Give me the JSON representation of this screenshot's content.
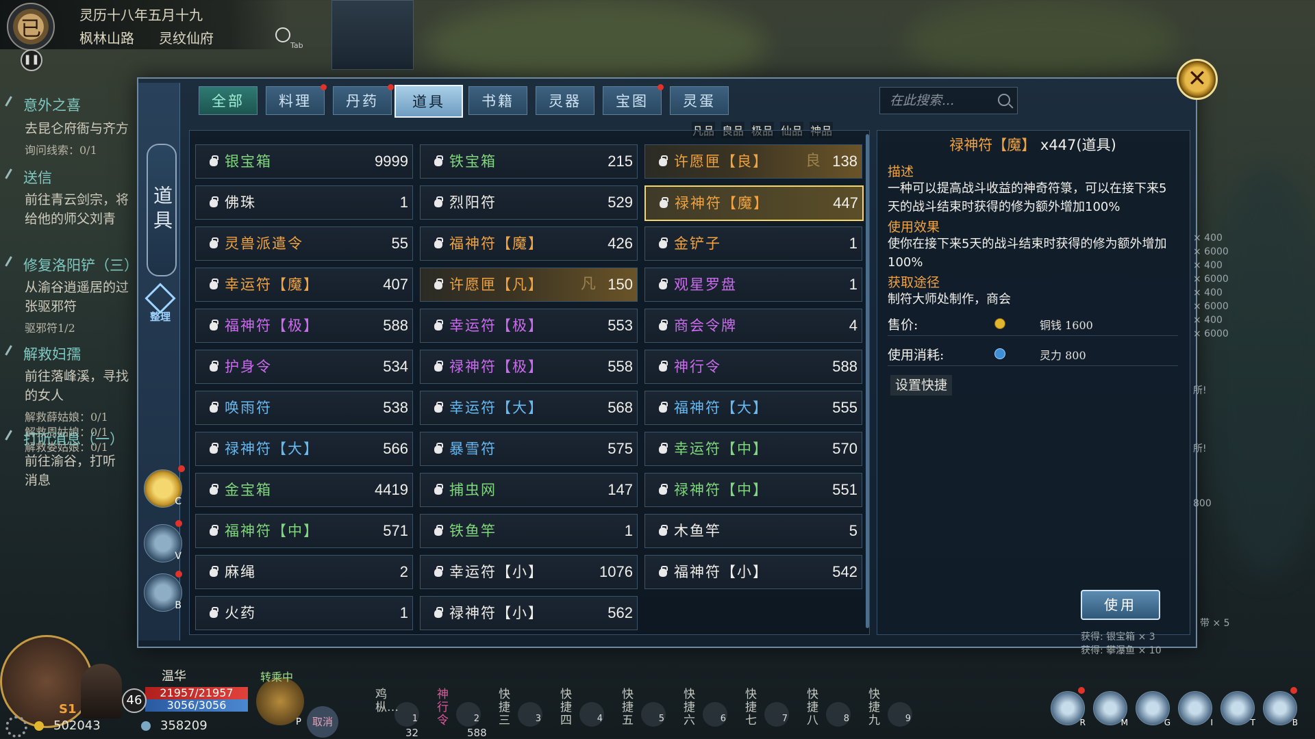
{
  "hud": {
    "emblem": "已",
    "date": "灵历十八年五月十九",
    "location": "枫林山路",
    "location2": "灵纹仙府",
    "search_key": "Tab"
  },
  "quests": [
    {
      "title": "意外之喜",
      "lines": [
        "去昆仑府衙与齐方"
      ],
      "subs": [
        "询问线索：0/1"
      ]
    },
    {
      "title": "送信",
      "lines": [
        "前往青云剑宗，将",
        "给他的师父刘青"
      ],
      "subs": []
    },
    {
      "title": "修复洛阳铲（三）",
      "lines": [
        "从渝谷逍遥居的过",
        "张驱邪符"
      ],
      "subs": [
        "驱邪符1/2"
      ]
    },
    {
      "title": "解救妇孺",
      "lines": [
        "前往落峰溪，寻找",
        "的女人"
      ],
      "subs": [
        "解救薛姑娘：0/1",
        "解救周姑娘：0/1",
        "解救娄姑娘：0/1"
      ]
    },
    {
      "title": "打听消息（一）",
      "lines": [
        "前往渝谷，打听",
        "消息"
      ],
      "subs": []
    }
  ],
  "sidebar": {
    "category": "道具",
    "tidy": "整理",
    "buttons": [
      {
        "label": "道具",
        "key": "C"
      },
      {
        "label": "",
        "key": "V"
      },
      {
        "label": "",
        "key": "B"
      }
    ]
  },
  "tabs": [
    "全部",
    "料理",
    "丹药",
    "道具",
    "书籍",
    "灵器",
    "宝图",
    "灵蛋"
  ],
  "search": {
    "placeholder": "在此搜索..."
  },
  "grades": [
    "凡品",
    "良品",
    "极品",
    "仙品",
    "神品"
  ],
  "items": [
    [
      {
        "name": "银宝箱",
        "count": "9999",
        "color": "green"
      },
      {
        "name": "佛珠",
        "count": "1",
        "color": "white"
      },
      {
        "name": "灵兽派遣令",
        "count": "55",
        "color": "orange"
      },
      {
        "name": "幸运符【魔】",
        "count": "407",
        "color": "orange"
      },
      {
        "name": "福神符【极】",
        "count": "588",
        "color": "purple"
      },
      {
        "name": "护身令",
        "count": "534",
        "color": "purple"
      },
      {
        "name": "唤雨符",
        "count": "538",
        "color": "blue"
      },
      {
        "name": "禄神符【大】",
        "count": "566",
        "color": "blue"
      },
      {
        "name": "金宝箱",
        "count": "4419",
        "color": "green"
      },
      {
        "name": "福神符【中】",
        "count": "571",
        "color": "green"
      },
      {
        "name": "麻绳",
        "count": "2",
        "color": "white"
      },
      {
        "name": "火药",
        "count": "1",
        "color": "white"
      }
    ],
    [
      {
        "name": "铁宝箱",
        "count": "215",
        "color": "green"
      },
      {
        "name": "烈阳符",
        "count": "529",
        "color": "white"
      },
      {
        "name": "福神符【魔】",
        "count": "426",
        "color": "orange"
      },
      {
        "name": "许愿匣【凡】",
        "count": "150",
        "color": "orange",
        "grade": "凡"
      },
      {
        "name": "幸运符【极】",
        "count": "553",
        "color": "purple"
      },
      {
        "name": "禄神符【极】",
        "count": "558",
        "color": "purple"
      },
      {
        "name": "幸运符【大】",
        "count": "568",
        "color": "blue"
      },
      {
        "name": "暴雪符",
        "count": "575",
        "color": "blue"
      },
      {
        "name": "捕虫网",
        "count": "147",
        "color": "green"
      },
      {
        "name": "铁鱼竿",
        "count": "1",
        "color": "green"
      },
      {
        "name": "幸运符【小】",
        "count": "1076",
        "color": "white"
      },
      {
        "name": "禄神符【小】",
        "count": "562",
        "color": "white"
      }
    ],
    [
      {
        "name": "许愿匣【良】",
        "count": "138",
        "color": "orange",
        "grade": "良"
      },
      {
        "name": "禄神符【魔】",
        "count": "447",
        "color": "orange",
        "selected": true
      },
      {
        "name": "金铲子",
        "count": "1",
        "color": "orange"
      },
      {
        "name": "观星罗盘",
        "count": "1",
        "color": "purple"
      },
      {
        "name": "商会令牌",
        "count": "4",
        "color": "purple"
      },
      {
        "name": "神行令",
        "count": "588",
        "color": "purple"
      },
      {
        "name": "福神符【大】",
        "count": "555",
        "color": "blue"
      },
      {
        "name": "幸运符【中】",
        "count": "570",
        "color": "green"
      },
      {
        "name": "禄神符【中】",
        "count": "551",
        "color": "green"
      },
      {
        "name": "木鱼竿",
        "count": "5",
        "color": "white"
      },
      {
        "name": "福神符【小】",
        "count": "542",
        "color": "white"
      }
    ]
  ],
  "detail": {
    "name": "禄神符【魔】",
    "qty": "x447(道具)",
    "desc_head": "描述",
    "desc": "一种可以提高战斗收益的神奇符箓，可以在接下来5天的战斗结束时获得的修为额外增加100%",
    "effect_head": "使用效果",
    "effect": "使你在接下来5天的战斗结束时获得的修为额外增加100%",
    "source_head": "获取途径",
    "source": "制符大师处制作，商会",
    "price_label": "售价:",
    "price": "铜钱 1600",
    "cost_label": "使用消耗:",
    "cost": "灵力 800",
    "shortcut": "设置快捷",
    "use": "使用"
  },
  "right_log": [
    "× 400",
    "× 6000",
    "× 400",
    "× 6000",
    "× 400",
    "× 6000",
    "× 400",
    "× 6000",
    "所!",
    "所!",
    "800",
    "带 × 5",
    "获得: 银宝箱 × 3",
    "获得: 攀瀑鱼 × 10"
  ],
  "player": {
    "name": "温华",
    "hp": "21957/21957",
    "mp": "3056/3056",
    "level": "46",
    "badge": "S1",
    "copper": "502043",
    "spirit": "358209",
    "status": "转乘中",
    "cancel": "取消",
    "pet_key": "P"
  },
  "hotbar": [
    {
      "label": "鸡枞…",
      "num": "1",
      "cnt": "32",
      "red": false
    },
    {
      "label": "神行令",
      "num": "2",
      "cnt": "588",
      "red": true
    },
    {
      "label": "快捷三",
      "num": "3",
      "cnt": "",
      "red": false
    },
    {
      "label": "快捷四",
      "num": "4",
      "cnt": "",
      "red": false
    },
    {
      "label": "快捷五",
      "num": "5",
      "cnt": "",
      "red": false
    },
    {
      "label": "快捷六",
      "num": "6",
      "cnt": "",
      "red": false
    },
    {
      "label": "快捷七",
      "num": "7",
      "cnt": "",
      "red": false
    },
    {
      "label": "快捷八",
      "num": "8",
      "cnt": "",
      "red": false
    },
    {
      "label": "快捷九",
      "num": "9",
      "cnt": "",
      "red": false
    }
  ],
  "menu": [
    "R",
    "M",
    "G",
    "I",
    "T",
    "B"
  ],
  "colors": {
    "orange": "#f0a340",
    "purple": "#cc6bee",
    "blue": "#67b9f1",
    "green": "#7fd77b",
    "white": "#efede6",
    "accent": "#f5d66b"
  }
}
